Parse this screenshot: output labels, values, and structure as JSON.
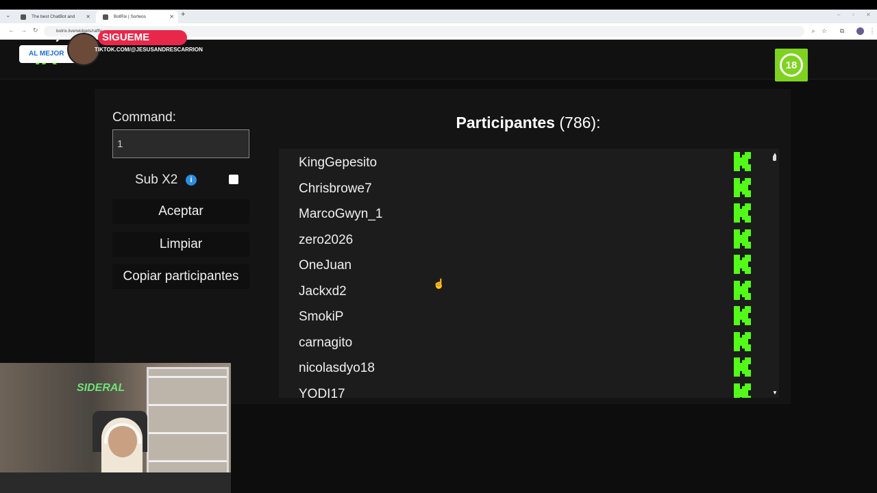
{
  "browser": {
    "tabs": [
      {
        "label": "The best ChatBot and Widgets"
      },
      {
        "label": "BotRix | Sorteos"
      }
    ],
    "url": "botrix.live/widgets/raffle"
  },
  "header": {
    "logo_text": "IX",
    "age_badge": "18",
    "overlay": {
      "pill": "AL MEJOR",
      "sigue": "SIGUEME",
      "handle": "TIKTOK.COM/@JESUSANDRESCARRION"
    }
  },
  "form": {
    "command_label": "Command:",
    "command_value": "1",
    "sub_label": "Sub X2",
    "info_icon": "i",
    "accept": "Aceptar",
    "clear": "Limpiar",
    "copy": "Copiar participantes"
  },
  "participants": {
    "title": "Participantes",
    "count": "(786):",
    "list": [
      "KingGepesito",
      "Chrisbrowe7",
      "MarcoGwyn_1",
      "zero2026",
      "OneJuan",
      "Jackxd2",
      "SmokiP",
      "carnagito",
      "nicolasdyo18",
      "YODI17"
    ]
  },
  "webcam": {
    "neon": "SIDERAL"
  },
  "colors": {
    "kick_green": "#53fc18",
    "badge_green": "#7ed321",
    "info_blue": "#2d8ee0"
  }
}
